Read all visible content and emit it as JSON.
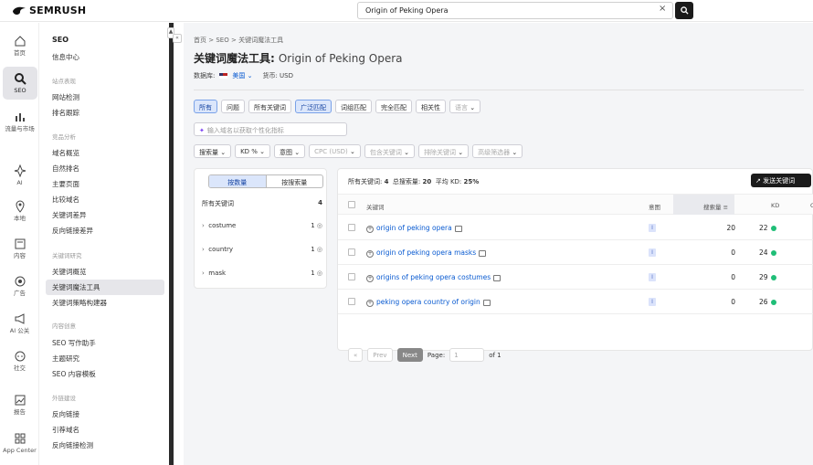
{
  "app": {
    "logo_text": "SEMRUSH"
  },
  "search": {
    "value": "Origin of Peking Opera",
    "clear": "×"
  },
  "rail": [
    {
      "label": "首页",
      "icon": "home-icon"
    },
    {
      "label": "SEO",
      "icon": "seo-icon",
      "active": true
    },
    {
      "label": "流量与市场",
      "icon": "traffic-icon"
    },
    {
      "label": "AI",
      "icon": "ai-icon"
    },
    {
      "label": "本地",
      "icon": "local-icon"
    },
    {
      "label": "内容",
      "icon": "content-icon"
    },
    {
      "label": "广告",
      "icon": "ads-icon"
    },
    {
      "label": "AI 公关",
      "icon": "pr-icon"
    },
    {
      "label": "社交",
      "icon": "social-icon"
    },
    {
      "label": "报告",
      "icon": "report-icon"
    },
    {
      "label": "App Center",
      "icon": "apps-icon"
    }
  ],
  "menu": {
    "title": "SEO",
    "dashboard": "信息中心",
    "sec1": "站点表现",
    "site_audit": "网站检测",
    "rank_tracking": "排名跟踪",
    "sec2": "竞品分析",
    "domain_overview": "域名概览",
    "organic_rankings": "自然排名",
    "top_pages": "主要页面",
    "compare_domains": "比较域名",
    "keyword_gap": "关键词差异",
    "backlink_gap": "反向链接差异",
    "sec3": "关键词研究",
    "keyword_overview": "关键词概览",
    "keyword_magic": "关键词魔法工具",
    "keyword_strategy": "关键词策略构建器",
    "sec4": "内容创意",
    "seo_writing": "SEO 写作助手",
    "topic_research": "主题研究",
    "seo_template": "SEO 内容模板",
    "sec5": "外链建设",
    "backlinks": "反向链接",
    "referring_domains": "引荐域名",
    "backlink_audit": "反向链接检测"
  },
  "breadcrumb": {
    "home": "首页",
    "sep": ">",
    "seo": "SEO",
    "tool": "关键词魔法工具"
  },
  "page": {
    "title": "关键词魔法工具:",
    "query": "Origin of Peking Opera",
    "db_label": "数据库:",
    "db_value": "美国",
    "currency": "货币: USD"
  },
  "tabs": [
    "所有",
    "问题",
    "所有关键词",
    "广泛匹配",
    "词组匹配",
    "完全匹配",
    "相关性"
  ],
  "language": "语言",
  "ai_input_placeholder": "输入域名以获取个性化指标",
  "filters": [
    "搜索量",
    "KD %",
    "意图",
    "CPC (USD)",
    "包含关键词",
    "排除关键词",
    "高级筛选器"
  ],
  "groups": {
    "by_count": "按数量",
    "by_volume": "按搜索量",
    "all_label": "所有关键词",
    "all_count": "4",
    "items": [
      {
        "name": "costume",
        "count": "1"
      },
      {
        "name": "country",
        "count": "1"
      },
      {
        "name": "mask",
        "count": "1"
      }
    ]
  },
  "summary": {
    "all_kw_label": "所有关键词:",
    "all_kw": "4",
    "total_vol_label": "总搜索量:",
    "total_vol": "20",
    "avg_kd_label": "平均 KD:",
    "avg_kd": "25%"
  },
  "send_button": "发送关键词",
  "table": {
    "headers": {
      "keyword": "关键词",
      "intent": "意图",
      "volume": "搜索量",
      "kd": "KD",
      "extra": "C"
    },
    "rows": [
      {
        "keyword": "origin of peking opera",
        "intent": "I",
        "volume": "20",
        "kd": "22"
      },
      {
        "keyword": "origin of peking opera masks",
        "intent": "I",
        "volume": "0",
        "kd": "24"
      },
      {
        "keyword": "origins of peking opera costumes",
        "intent": "I",
        "volume": "0",
        "kd": "29"
      },
      {
        "keyword": "peking opera country of origin",
        "intent": "I",
        "volume": "0",
        "kd": "26"
      }
    ]
  },
  "pager": {
    "first": "«",
    "prev": "Prev",
    "next": "Next",
    "page_label": "Page:",
    "page_value": "1",
    "of": "of 1"
  },
  "colors": {
    "accent": "#0a5bd1",
    "kd_green": "#1fbe77",
    "dark": "#1b1b1b"
  }
}
